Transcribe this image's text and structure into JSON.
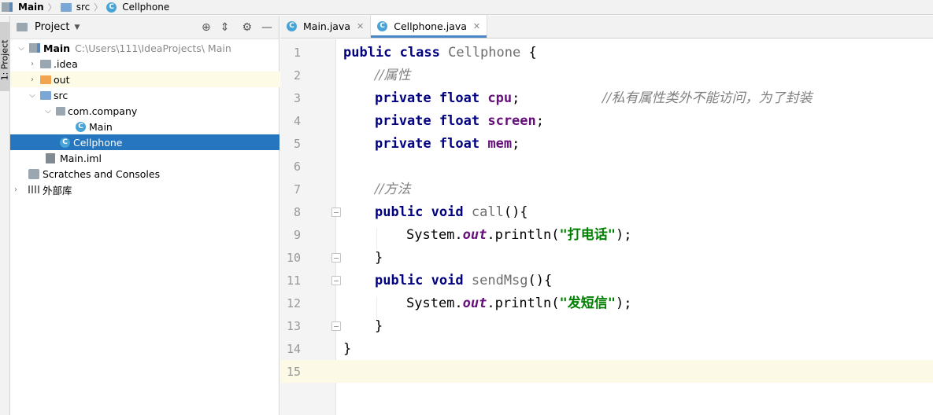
{
  "breadcrumb": {
    "items": [
      {
        "label": "Main",
        "icon": "module-icon"
      },
      {
        "label": "src",
        "icon": "folder-icon"
      },
      {
        "label": "Cellphone",
        "icon": "class-icon"
      }
    ]
  },
  "stripe": {
    "project_tab": "1: Project"
  },
  "project_panel": {
    "title": "Project",
    "tree": [
      {
        "label": "Main",
        "hint": "C:\\Users\\111\\IdeaProjects\\ Main",
        "icon": "module-icon",
        "expanded": true
      },
      {
        "label": ".idea",
        "icon": "folder-icon",
        "expanded": false
      },
      {
        "label": "out",
        "icon": "folder-orange-icon",
        "expanded": false
      },
      {
        "label": "src",
        "icon": "folder-blue-icon",
        "expanded": true
      },
      {
        "label": "com.company",
        "icon": "package-icon",
        "expanded": true
      },
      {
        "label": "Main",
        "icon": "class-icon"
      },
      {
        "label": "Cellphone",
        "icon": "class-icon",
        "selected": true
      },
      {
        "label": "Main.iml",
        "icon": "iml-icon"
      },
      {
        "label": "Scratches and Consoles",
        "icon": "scratches-icon"
      },
      {
        "label": "外部库",
        "icon": "library-icon",
        "expanded": false
      }
    ]
  },
  "editor": {
    "tabs": [
      {
        "label": "Main.java",
        "active": false
      },
      {
        "label": "Cellphone.java",
        "active": true
      }
    ],
    "line_numbers": [
      "1",
      "2",
      "3",
      "4",
      "5",
      "6",
      "7",
      "8",
      "9",
      "10",
      "11",
      "12",
      "13",
      "14",
      "15"
    ],
    "code": {
      "l1_kw1": "public",
      "l1_kw2": "class",
      "l1_name": "Cellphone",
      "l1_brace": "{",
      "l2_cmt": "//属性",
      "l3_kw1": "private",
      "l3_kw2": "float",
      "l3_field": "cpu",
      "l3_semi": ";",
      "l3_cmt": "//私有属性类外不能访问，为了封装",
      "l4_kw1": "private",
      "l4_kw2": "float",
      "l4_field": "screen",
      "l4_semi": ";",
      "l5_kw1": "private",
      "l5_kw2": "float",
      "l5_field": "mem",
      "l5_semi": ";",
      "l7_cmt": "//方法",
      "l8_kw1": "public",
      "l8_kw2": "void",
      "l8_name": "call",
      "l8_rest": "(){",
      "l9_a": "System.",
      "l9_out": "out",
      "l9_b": ".println(",
      "l9_str": "\"打电话\"",
      "l9_c": ");",
      "l10": "}",
      "l11_kw1": "public",
      "l11_kw2": "void",
      "l11_name": "sendMsg",
      "l11_rest": "(){",
      "l12_a": "System.",
      "l12_out": "out",
      "l12_b": ".println(",
      "l12_str": "\"发短信\"",
      "l12_c": ");",
      "l13": "}",
      "l14": "}"
    }
  }
}
